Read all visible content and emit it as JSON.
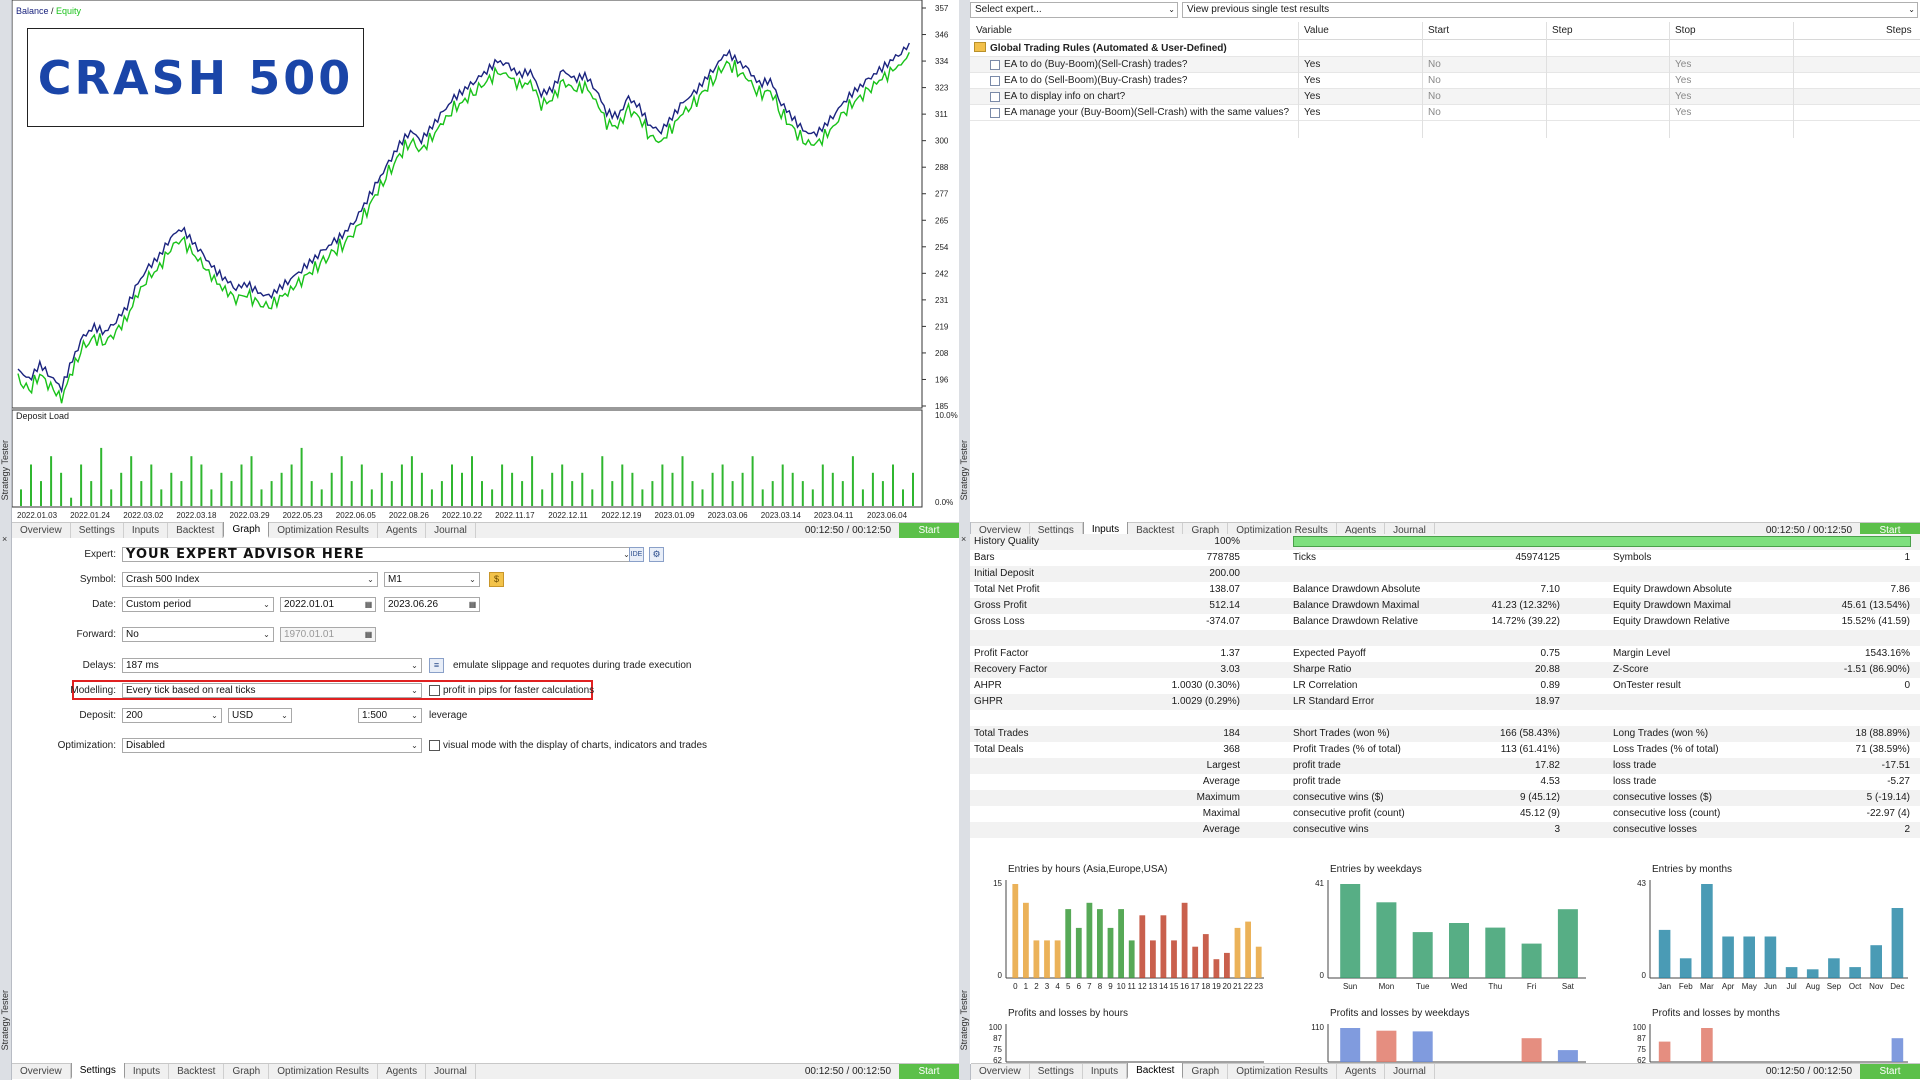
{
  "strip_labels": {
    "left_top": "Strategy Tester",
    "left_bottom": "Strategy Tester",
    "mid_top": "Strategy Tester",
    "mid_bottom": "Strategy Tester",
    "close": "×"
  },
  "chart": {
    "legend_balance": "Balance",
    "legend_sep": " / ",
    "legend_equity": "Equity",
    "banner": "CRASH 500",
    "deposit_label": "Deposit Load",
    "balance_color": "#1a237e",
    "equity_color": "#19c219",
    "deposit_color": "#2fb62f"
  },
  "chart_data": [
    {
      "type": "line",
      "series": [
        {
          "name": "Balance"
        },
        {
          "name": "Equity"
        }
      ],
      "y_ticks": [
        "357",
        "346",
        "334",
        "323",
        "311",
        "300",
        "288",
        "277",
        "265",
        "254",
        "242",
        "231",
        "219",
        "208",
        "196",
        "185"
      ],
      "ylim": [
        185,
        357
      ],
      "y": [
        201,
        196,
        203,
        198,
        193,
        205,
        215,
        219,
        217,
        222,
        228,
        238,
        245,
        250,
        258,
        262,
        256,
        250,
        244,
        240,
        236,
        238,
        234,
        232,
        236,
        240,
        244,
        248,
        252,
        256,
        260,
        266,
        274,
        282,
        290,
        298,
        304,
        300,
        306,
        312,
        318,
        322,
        326,
        330,
        334,
        332,
        328,
        330,
        320,
        322,
        330,
        326,
        328,
        322,
        312,
        310,
        318,
        314,
        306,
        304,
        310,
        316,
        320,
        326,
        332,
        338,
        334,
        330,
        324,
        326,
        316,
        310,
        304,
        302,
        306,
        312,
        318,
        322,
        326,
        330,
        334,
        338,
        342
      ]
    },
    {
      "type": "bar",
      "title": "Deposit Load",
      "y_ticks": [
        "10.0%",
        "0.0%"
      ],
      "ylim": [
        0,
        10
      ],
      "x_ticks": [
        "2022.01.03",
        "2022.01.24",
        "2022.03.02",
        "2022.03.18",
        "2022.03.29",
        "2022.05.23",
        "2022.06.05",
        "2022.08.26",
        "2022.10.22",
        "2022.11.17",
        "2022.12.11",
        "2022.12.19",
        "2023.01.09",
        "2023.03.06",
        "2023.03.14",
        "2023.04.11",
        "2023.06.04"
      ],
      "values": [
        2,
        5,
        3,
        6,
        4,
        1,
        5,
        3,
        7,
        2,
        4,
        6,
        3,
        5,
        2,
        4,
        3,
        6,
        5,
        2,
        4,
        3,
        5,
        6,
        2,
        3,
        4,
        5,
        7,
        3,
        2,
        4,
        6,
        3,
        5,
        2,
        4,
        3,
        5,
        6,
        4,
        2,
        3,
        5,
        4,
        6,
        3,
        2,
        5,
        4,
        3,
        6,
        2,
        4,
        5,
        3,
        4,
        2,
        6,
        3,
        5,
        4,
        2,
        3,
        5,
        4,
        6,
        3,
        2,
        4,
        5,
        3,
        4,
        6,
        2,
        3,
        5,
        4,
        3,
        2,
        5,
        4,
        3,
        6,
        2,
        4,
        3,
        5,
        2,
        4
      ]
    },
    {
      "type": "bar",
      "title": "Entries by hours (Asia,Europe,USA)",
      "y_ticks": [
        "15",
        "0"
      ],
      "categories": [
        "0",
        "1",
        "2",
        "3",
        "4",
        "5",
        "6",
        "7",
        "8",
        "9",
        "10",
        "11",
        "12",
        "13",
        "14",
        "15",
        "16",
        "17",
        "18",
        "19",
        "20",
        "21",
        "22",
        "23"
      ],
      "values": [
        15,
        12,
        6,
        6,
        6,
        11,
        8,
        12,
        11,
        8,
        11,
        6,
        10,
        6,
        10,
        6,
        12,
        5,
        7,
        3,
        4,
        8,
        9,
        5
      ],
      "colors": [
        "#e8a43c",
        "#e8a43c",
        "#e8a43c",
        "#e8a43c",
        "#e8a43c",
        "#3a9a3a",
        "#3a9a3a",
        "#3a9a3a",
        "#3a9a3a",
        "#3a9a3a",
        "#3a9a3a",
        "#3a9a3a",
        "#c0442e",
        "#c0442e",
        "#c0442e",
        "#c0442e",
        "#c0442e",
        "#c0442e",
        "#c0442e",
        "#c0442e",
        "#c0442e",
        "#e8a43c",
        "#e8a43c",
        "#e8a43c"
      ]
    },
    {
      "type": "bar",
      "title": "Entries by weekdays",
      "y_ticks": [
        "41",
        "0"
      ],
      "categories": [
        "Sun",
        "Mon",
        "Tue",
        "Wed",
        "Thu",
        "Fri",
        "Sat"
      ],
      "values": [
        41,
        33,
        20,
        24,
        22,
        15,
        30
      ],
      "colors": [
        "#3aa070",
        "#3aa070",
        "#3aa070",
        "#3aa070",
        "#3aa070",
        "#3aa070",
        "#3aa070"
      ]
    },
    {
      "type": "bar",
      "title": "Entries by months",
      "y_ticks": [
        "43",
        "0"
      ],
      "categories": [
        "Jan",
        "Feb",
        "Mar",
        "Apr",
        "May",
        "Jun",
        "Jul",
        "Aug",
        "Sep",
        "Oct",
        "Nov",
        "Dec"
      ],
      "values": [
        22,
        9,
        43,
        19,
        19,
        19,
        5,
        4,
        9,
        5,
        15,
        32
      ],
      "colors": [
        "#2a8aa8",
        "#2a8aa8",
        "#2a8aa8",
        "#2a8aa8",
        "#2a8aa8",
        "#2a8aa8",
        "#2a8aa8",
        "#2a8aa8",
        "#2a8aa8",
        "#2a8aa8",
        "#2a8aa8",
        "#2a8aa8"
      ]
    },
    {
      "type": "bar",
      "title": "Profits and losses by hours",
      "y_ticks": [
        "100",
        "87",
        "75",
        "62"
      ]
    },
    {
      "type": "bar",
      "title": "Profits and losses by weekdays",
      "y_ticks": [
        "110"
      ],
      "values": [
        100,
        92,
        90,
        0,
        0,
        70,
        35
      ]
    },
    {
      "type": "bar",
      "title": "Profits and losses by months",
      "y_ticks": [
        "100",
        "87",
        "75",
        "62"
      ],
      "values": [
        60,
        0,
        100,
        0,
        0,
        0,
        0,
        0,
        0,
        0,
        0,
        70
      ]
    }
  ],
  "left_tabs_top": [
    "Overview",
    "Settings",
    "Inputs",
    "Backtest",
    "Graph",
    "Optimization Results",
    "Agents",
    "Journal"
  ],
  "left_tabs_top_active": "Graph",
  "left_tabs_bottom": [
    "Overview",
    "Settings",
    "Inputs",
    "Backtest",
    "Graph",
    "Optimization Results",
    "Agents",
    "Journal"
  ],
  "left_tabs_bottom_active": "Settings",
  "right_tabs_top": [
    "Overview",
    "Settings",
    "Inputs",
    "Backtest",
    "Graph",
    "Optimization Results",
    "Agents",
    "Journal"
  ],
  "right_tabs_top_active": "Inputs",
  "right_tabs_bottom": [
    "Overview",
    "Settings",
    "Inputs",
    "Backtest",
    "Graph",
    "Optimization Results",
    "Agents",
    "Journal"
  ],
  "right_tabs_bottom_active": "Backtest",
  "timer": "00:12:50 / 00:12:50",
  "start_label": "Start",
  "settings": {
    "expert_label": "Expert:",
    "expert_value": "YOUR EXPERT ADVISOR HERE",
    "expert_btn1": "IDE",
    "expert_btn2": "⚙",
    "symbol_label": "Symbol:",
    "symbol_value": "Crash 500 Index",
    "timeframe_value": "M1",
    "date_label": "Date:",
    "date_mode": "Custom period",
    "date_from": "2022.01.01",
    "date_to": "2023.06.26",
    "forward_label": "Forward:",
    "forward_value": "No",
    "forward_date": "1970.01.01",
    "delays_label": "Delays:",
    "delays_value": "187 ms",
    "delays_note": "emulate slippage and requotes during trade execution",
    "modelling_label": "Modelling:",
    "modelling_value": "Every tick based on real ticks",
    "modelling_check": "profit in pips for faster calculations",
    "deposit_label": "Deposit:",
    "deposit_value": "200",
    "currency_value": "USD",
    "leverage_value": "1:500",
    "leverage_label": "leverage",
    "optimization_label": "Optimization:",
    "optimization_value": "Disabled",
    "visual_note": "visual mode with the display of charts, indicators and trades",
    "highlight_color": "#e02020"
  },
  "inputs": {
    "select_expert": "Select expert...",
    "view_previous": "View previous single test results",
    "columns": [
      "Variable",
      "Value",
      "Start",
      "Step",
      "Stop",
      "Steps"
    ],
    "group": "Global Trading Rules (Automated & User-Defined)",
    "rows": [
      {
        "variable": "EA to do (Buy-Boom)(Sell-Crash) trades?",
        "value": "Yes",
        "start": "No",
        "stop": "Yes"
      },
      {
        "variable": "EA to do (Sell-Boom)(Buy-Crash) trades?",
        "value": "Yes",
        "start": "No",
        "stop": "Yes"
      },
      {
        "variable": "EA to display info on chart?",
        "value": "Yes",
        "start": "No",
        "stop": "Yes"
      },
      {
        "variable": "EA manage your (Buy-Boom)(Sell-Crash) with the same values?",
        "value": "Yes",
        "start": "No",
        "stop": "Yes"
      }
    ]
  },
  "stats": {
    "history_quality_label": "History Quality",
    "history_quality_value": "100%",
    "history_quality_fill": 1.0,
    "rows": [
      [
        "Bars",
        "778785",
        "Ticks",
        "45974125",
        "Symbols",
        "1"
      ],
      [
        "Initial Deposit",
        "200.00",
        "",
        "",
        "",
        ""
      ],
      [
        "Total Net Profit",
        "138.07",
        "Balance Drawdown Absolute",
        "7.10",
        "Equity Drawdown Absolute",
        "7.86"
      ],
      [
        "Gross Profit",
        "512.14",
        "Balance Drawdown Maximal",
        "41.23 (12.32%)",
        "Equity Drawdown Maximal",
        "45.61 (13.54%)"
      ],
      [
        "Gross Loss",
        "-374.07",
        "Balance Drawdown Relative",
        "14.72% (39.22)",
        "Equity Drawdown Relative",
        "15.52% (41.59)"
      ],
      [
        "",
        "",
        "",
        "",
        "",
        ""
      ],
      [
        "Profit Factor",
        "1.37",
        "Expected Payoff",
        "0.75",
        "Margin Level",
        "1543.16%"
      ],
      [
        "Recovery Factor",
        "3.03",
        "Sharpe Ratio",
        "20.88",
        "Z-Score",
        "-1.51 (86.90%)"
      ],
      [
        "AHPR",
        "1.0030 (0.30%)",
        "LR Correlation",
        "0.89",
        "OnTester result",
        "0"
      ],
      [
        "GHPR",
        "1.0029 (0.29%)",
        "LR Standard Error",
        "18.97",
        "",
        ""
      ],
      [
        "",
        "",
        "",
        "",
        "",
        ""
      ],
      [
        "Total Trades",
        "184",
        "Short Trades (won %)",
        "166 (58.43%)",
        "Long Trades (won %)",
        "18 (88.89%)"
      ],
      [
        "Total Deals",
        "368",
        "Profit Trades (% of total)",
        "113 (61.41%)",
        "Loss Trades (% of total)",
        "71 (38.59%)"
      ],
      [
        "",
        "Largest",
        "profit trade",
        "17.82",
        "loss trade",
        "-17.51"
      ],
      [
        "",
        "Average",
        "profit trade",
        "4.53",
        "loss trade",
        "-5.27"
      ],
      [
        "",
        "Maximum",
        "consecutive wins ($)",
        "9 (45.12)",
        "consecutive losses ($)",
        "5 (-19.14)"
      ],
      [
        "",
        "Maximal",
        "consecutive profit (count)",
        "45.12 (9)",
        "consecutive loss (count)",
        "-22.97 (4)"
      ],
      [
        "",
        "Average",
        "consecutive wins",
        "3",
        "consecutive losses",
        "2"
      ]
    ]
  }
}
